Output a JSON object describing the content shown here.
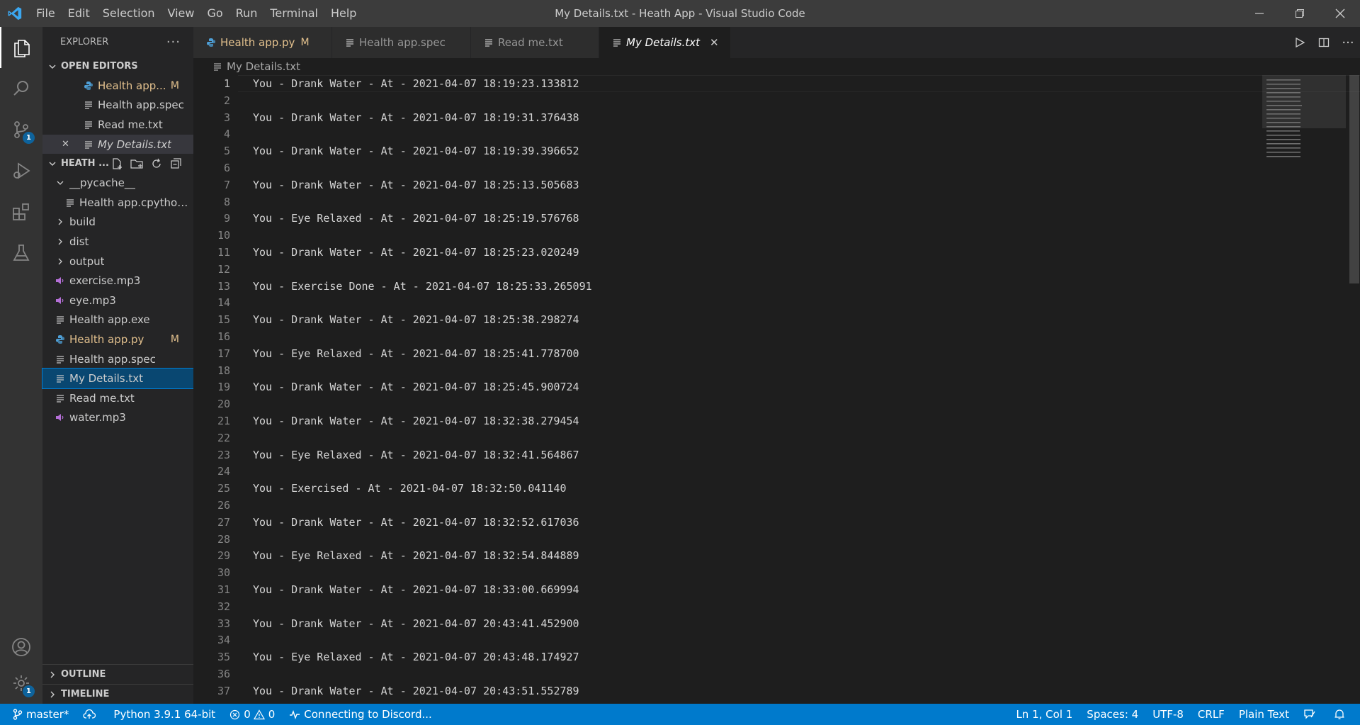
{
  "window": {
    "title": "My Details.txt - Heath App - Visual Studio Code",
    "menu": [
      "File",
      "Edit",
      "Selection",
      "View",
      "Go",
      "Run",
      "Terminal",
      "Help"
    ]
  },
  "activity_bar": {
    "scm_badge": "1",
    "settings_badge": "1"
  },
  "sidebar": {
    "title": "EXPLORER",
    "open_editors_label": "OPEN EDITORS",
    "open_editors": [
      {
        "label": "Health app...",
        "flag": "M",
        "icon": "python-icon"
      },
      {
        "label": "Health app.spec",
        "icon": "file-lines-icon"
      },
      {
        "label": "Read me.txt",
        "icon": "file-lines-icon"
      },
      {
        "label": "My Details.txt",
        "icon": "file-lines-icon"
      }
    ],
    "workspace_label": "HEATH ...",
    "tree": [
      {
        "label": "__pycache__",
        "kind": "folder-open",
        "depth": 1
      },
      {
        "label": "Health app.cpython-...",
        "kind": "file",
        "depth": 2
      },
      {
        "label": "build",
        "kind": "folder",
        "depth": 1
      },
      {
        "label": "dist",
        "kind": "folder",
        "depth": 1
      },
      {
        "label": "output",
        "kind": "folder",
        "depth": 1
      },
      {
        "label": "exercise.mp3",
        "kind": "audio",
        "depth": 1
      },
      {
        "label": "eye.mp3",
        "kind": "audio",
        "depth": 1
      },
      {
        "label": "Health app.exe",
        "kind": "file",
        "depth": 1
      },
      {
        "label": "Health app.py",
        "kind": "python",
        "depth": 1,
        "flag": "M"
      },
      {
        "label": "Health app.spec",
        "kind": "file",
        "depth": 1
      },
      {
        "label": "My Details.txt",
        "kind": "file",
        "depth": 1,
        "selected": true
      },
      {
        "label": "Read me.txt",
        "kind": "file",
        "depth": 1
      },
      {
        "label": "water.mp3",
        "kind": "audio",
        "depth": 1
      }
    ],
    "outline_label": "OUTLINE",
    "timeline_label": "TIMELINE"
  },
  "tabs": [
    {
      "label": "Health app.py",
      "flag": "M",
      "icon": "python-icon"
    },
    {
      "label": "Health app.spec",
      "icon": "file-lines-icon"
    },
    {
      "label": "Read me.txt",
      "icon": "file-lines-icon"
    },
    {
      "label": "My Details.txt",
      "icon": "file-lines-icon",
      "active": true,
      "close": "✕"
    }
  ],
  "breadcrumb": "My Details.txt",
  "editor_lines": [
    "You - Drank Water - At - 2021-04-07 18:19:23.133812",
    "",
    "You - Drank Water - At - 2021-04-07 18:19:31.376438",
    "",
    "You - Drank Water - At - 2021-04-07 18:19:39.396652",
    "",
    "You - Drank Water - At - 2021-04-07 18:25:13.505683",
    "",
    "You - Eye Relaxed - At - 2021-04-07 18:25:19.576768",
    "",
    "You - Drank Water - At - 2021-04-07 18:25:23.020249",
    "",
    "You - Exercise Done - At - 2021-04-07 18:25:33.265091",
    "",
    "You - Drank Water - At - 2021-04-07 18:25:38.298274",
    "",
    "You - Eye Relaxed - At - 2021-04-07 18:25:41.778700",
    "",
    "You - Drank Water - At - 2021-04-07 18:25:45.900724",
    "",
    "You - Drank Water - At - 2021-04-07 18:32:38.279454",
    "",
    "You - Eye Relaxed - At - 2021-04-07 18:32:41.564867",
    "",
    "You - Exercised - At - 2021-04-07 18:32:50.041140",
    "",
    "You - Drank Water - At - 2021-04-07 18:32:52.617036",
    "",
    "You - Eye Relaxed - At - 2021-04-07 18:32:54.844889",
    "",
    "You - Drank Water - At - 2021-04-07 18:33:00.669994",
    "",
    "You - Drank Water - At - 2021-04-07 20:43:41.452900",
    "",
    "You - Eye Relaxed - At - 2021-04-07 20:43:48.174927",
    "",
    "You - Drank Water - At - 2021-04-07 20:43:51.552789"
  ],
  "status": {
    "branch": "master*",
    "python": "Python 3.9.1 64-bit",
    "errors": "0",
    "warnings": "0",
    "discord": "Connecting to Discord...",
    "position": "Ln 1, Col 1",
    "spaces": "Spaces: 4",
    "encoding": "UTF-8",
    "eol": "CRLF",
    "language": "Plain Text"
  },
  "colors": {
    "accent": "#007acc",
    "modified": "#e2c08d",
    "selection": "#094771"
  }
}
